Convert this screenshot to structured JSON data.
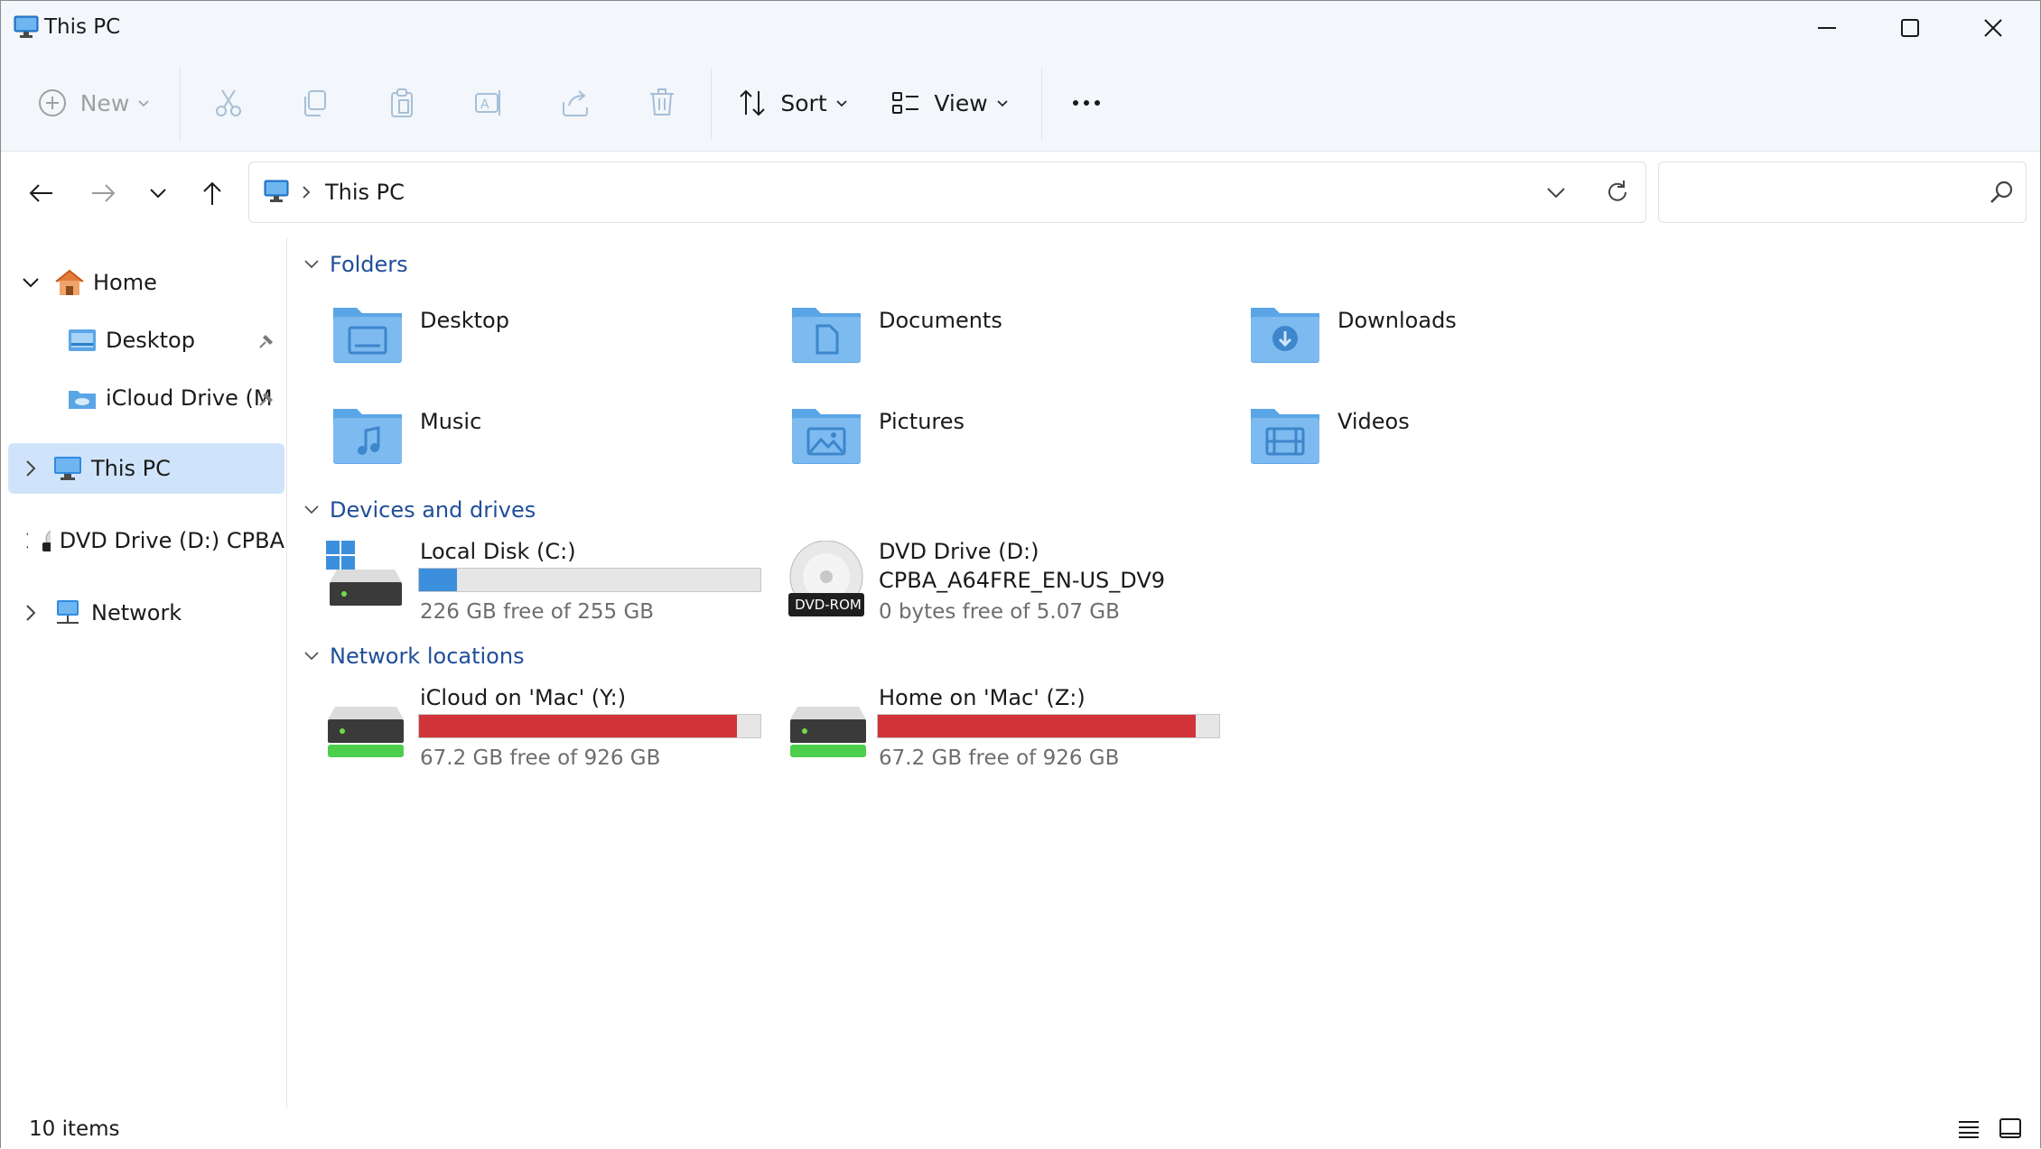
{
  "window": {
    "title": "This PC"
  },
  "toolbar": {
    "new_label": "New",
    "sort_label": "Sort",
    "view_label": "View"
  },
  "address": {
    "location": "This PC"
  },
  "sidebar": {
    "items": [
      {
        "label": "Home"
      },
      {
        "label": "Desktop"
      },
      {
        "label": "iCloud Drive (M"
      },
      {
        "label": "This PC"
      },
      {
        "label": "DVD Drive (D:) CPBA"
      },
      {
        "label": "Network"
      }
    ]
  },
  "sections": {
    "folders": "Folders",
    "devices": "Devices and drives",
    "network": "Network locations"
  },
  "folders": [
    {
      "name": "Desktop"
    },
    {
      "name": "Documents"
    },
    {
      "name": "Downloads"
    },
    {
      "name": "Music"
    },
    {
      "name": "Pictures"
    },
    {
      "name": "Videos"
    }
  ],
  "drives": [
    {
      "name": "Local Disk (C:)",
      "space": "226 GB free of 255 GB",
      "used_fraction": 0.11,
      "bar_color": "#3c8fdc"
    },
    {
      "name": "DVD Drive (D:)",
      "name2": "CPBA_A64FRE_EN-US_DV9",
      "space": "0 bytes free of 5.07 GB",
      "badge": "DVD-ROM"
    }
  ],
  "network_locations": [
    {
      "name": "iCloud on 'Mac' (Y:)",
      "space": "67.2 GB free of 926 GB",
      "used_fraction": 0.93,
      "bar_color": "#d13438"
    },
    {
      "name": "Home on 'Mac' (Z:)",
      "space": "67.2 GB free of 926 GB",
      "used_fraction": 0.93,
      "bar_color": "#d13438"
    }
  ],
  "status": {
    "items": "10 items"
  },
  "colors": {
    "accent": "#1f4e9a",
    "selection": "#cfe4fa",
    "folder": "#5aa5e6"
  }
}
